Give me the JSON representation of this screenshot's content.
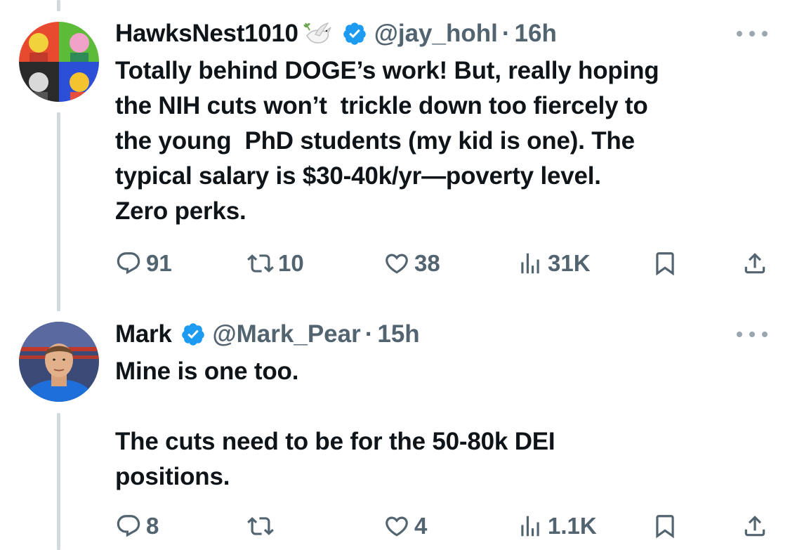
{
  "tweets": [
    {
      "display_name": "HawksNest1010",
      "emoji": "dove-emoji",
      "handle": "@jay_hohl",
      "separator": "·",
      "time": "16h",
      "text": "Totally behind DOGE’s work! But, really hoping\nthe NIH cuts won’t  trickle down too fiercely to\nthe young  PhD students (my kid is one). The\ntypical salary is $30-40k/yr—poverty level.\nZero perks.",
      "replies": "91",
      "reposts": "10",
      "likes": "38",
      "views": "31K"
    },
    {
      "display_name": "Mark",
      "handle": "@Mark_Pear",
      "separator": "·",
      "time": "15h",
      "text": "Mine is one too.\n\nThe cuts need to be for the 50-80k DEI\npositions.",
      "replies": "8",
      "reposts": "",
      "likes": "4",
      "views": "1.1K"
    }
  ],
  "colors": {
    "verified": "#1d9bf0",
    "muted": "#536471",
    "thread_line": "#cfd9de",
    "text": "#0f1419"
  },
  "icons": [
    "reply-icon",
    "repost-icon",
    "like-icon",
    "views-icon",
    "bookmark-icon",
    "share-icon",
    "more-icon",
    "verified-badge-icon"
  ]
}
